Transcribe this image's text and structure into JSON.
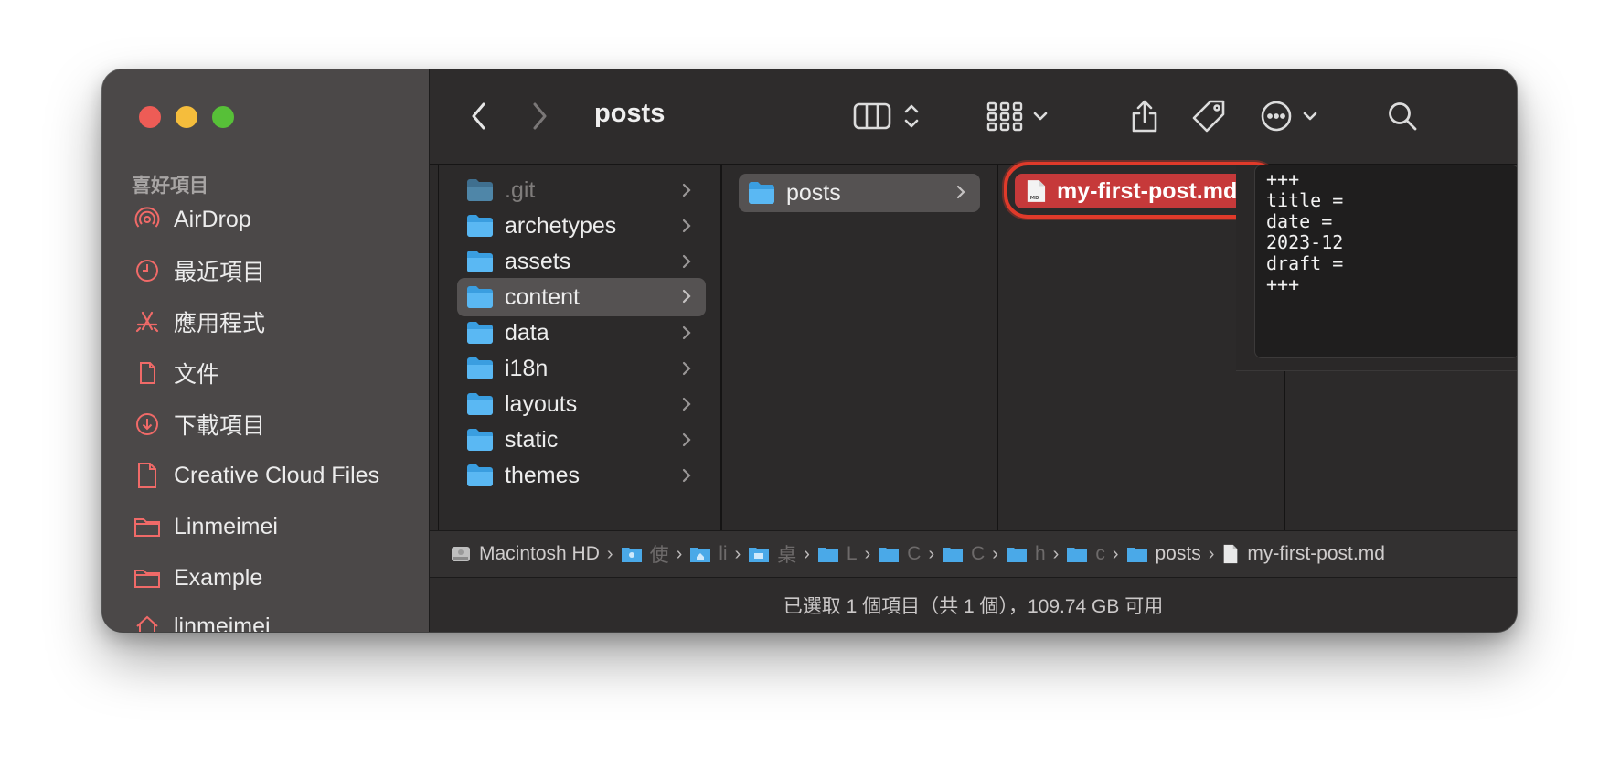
{
  "window": {
    "title": "posts"
  },
  "sidebar": {
    "section_title": "喜好項目",
    "items": [
      {
        "label": "AirDrop",
        "icon": "airdrop-icon"
      },
      {
        "label": "最近項目",
        "icon": "clock-icon"
      },
      {
        "label": "應用程式",
        "icon": "applications-icon"
      },
      {
        "label": "文件",
        "icon": "document-icon"
      },
      {
        "label": "下載項目",
        "icon": "download-icon"
      },
      {
        "label": "Creative Cloud Files",
        "icon": "file-icon"
      },
      {
        "label": "Linmeimei",
        "icon": "folder-icon"
      },
      {
        "label": "Example",
        "icon": "folder-icon"
      },
      {
        "label": "linmeimei",
        "icon": "home-icon"
      }
    ]
  },
  "toolbar": {
    "back": "back-icon",
    "forward": "forward-icon",
    "view_mode": "columns-view-icon",
    "group": "group-icon",
    "share": "share-icon",
    "tags": "tag-icon",
    "more": "more-icon",
    "search": "search-icon"
  },
  "columns": {
    "col1": [
      {
        "label": ".git",
        "dim": true
      },
      {
        "label": "archetypes"
      },
      {
        "label": "assets"
      },
      {
        "label": "content",
        "selected": true
      },
      {
        "label": "data"
      },
      {
        "label": "i18n"
      },
      {
        "label": "layouts"
      },
      {
        "label": "static"
      },
      {
        "label": "themes"
      }
    ],
    "col2": [
      {
        "label": "posts",
        "selected": true
      }
    ],
    "col3": [
      {
        "label": "my-first-post.md",
        "selected": true
      }
    ]
  },
  "preview": {
    "text": "+++\ntitle =\ndate =\n2023-12\ndraft =\n+++"
  },
  "pathbar": {
    "root": "Macintosh HD",
    "truncated": [
      "使",
      "li",
      "桌",
      "L",
      "C",
      "C",
      "h",
      "c"
    ],
    "posts": "posts",
    "file": "my-first-post.md"
  },
  "status": {
    "text": "已選取 1 個項目（共 1 個），109.74 GB 可用"
  },
  "colors": {
    "accent_selection": "#c6393a",
    "highlight_ring": "#e03a2a",
    "folder": "#56b3f0",
    "sidebar_icon": "#f06a68"
  }
}
